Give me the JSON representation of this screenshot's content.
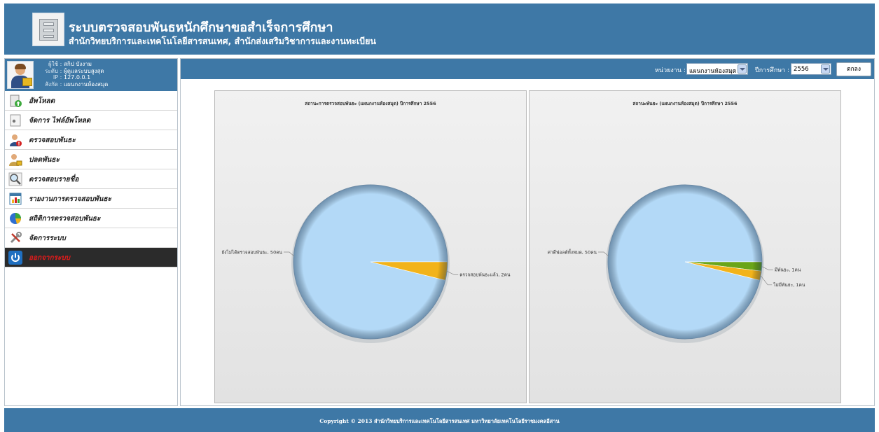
{
  "header": {
    "title": "ระบบตรวจสอบพันธหนักศึกษาขอสำเร็จการศึกษา",
    "subtitle": "สำนักวิทยบริการและเทคโนโลยีสารสนเทศ, สำนักส่งเสริมวิชาการและงานทะเบียน"
  },
  "user": {
    "name_label": "ผู้ใช้",
    "name": "สกิป บังงาม",
    "level_label": "ระดับ",
    "level": "ผู้ดูแลระบบสูงสุด",
    "ip_label": "IP",
    "ip": "127.0.0.1",
    "dept_label": "สังกัด",
    "dept": "แผนกงานห้องสมุด"
  },
  "menu": [
    {
      "label": "อัพโหลด",
      "icon": "upload-icon"
    },
    {
      "label": "จัดการ ไฟล์อัพโหลด",
      "icon": "file-manage-icon"
    },
    {
      "label": "ตรวจสอบพันธะ",
      "icon": "check-obligation-icon"
    },
    {
      "label": "ปลดพันธะ",
      "icon": "release-obligation-icon"
    },
    {
      "label": "ตรวจสอบรายชื่อ",
      "icon": "search-names-icon"
    },
    {
      "label": "รายงานการตรวจสอบพันธะ",
      "icon": "report-icon"
    },
    {
      "label": "สถิติการตรวจสอบพันธะ",
      "icon": "pie-chart-icon"
    },
    {
      "label": "จัดการระบบ",
      "icon": "tools-icon"
    },
    {
      "label": "ออกจากระบบ",
      "icon": "power-icon"
    }
  ],
  "toolbar": {
    "unit_label": "หน่วยงาน :",
    "unit_value": "แผนกงานห้องสมุด",
    "year_label": "ปีการศึกษา :",
    "year_value": "2556",
    "ok_label": "ตกลง"
  },
  "chart_data": [
    {
      "type": "pie",
      "title": "สถานะการตรวจสอบพันธะ (แผนกงานห้องสมุด) ปีการศึกษา 2556",
      "slices": [
        {
          "label": "ยังไม่ได้ตรวจสอบพันธะ, 50คน",
          "value": 50,
          "color": "#b3d9f7"
        },
        {
          "label": "ตรวจสอบพันธะแล้ว, 2คน",
          "value": 2,
          "color": "#f2b31a"
        }
      ]
    },
    {
      "type": "pie",
      "title": "สถานะพันธะ (แผนกงานห้องสมุด) ปีการศึกษา 2556",
      "slices": [
        {
          "label": "ค่าดีฟอลต์ทั้งหมด, 50คน",
          "value": 50,
          "color": "#b3d9f7"
        },
        {
          "label": "มีพันธะ, 1คน",
          "value": 1,
          "color": "#6aa51a"
        },
        {
          "label": "ไม่มีพันธะ, 1คน",
          "value": 1,
          "color": "#f2b31a"
        }
      ]
    }
  ],
  "footer": {
    "copyright": "Copyright © 2013 สำนักวิทยบริการและเทคโนโลยีสารสนเทศ มหาวิทยาลัยเทคโนโลยีราชมงคลอีสาน"
  }
}
